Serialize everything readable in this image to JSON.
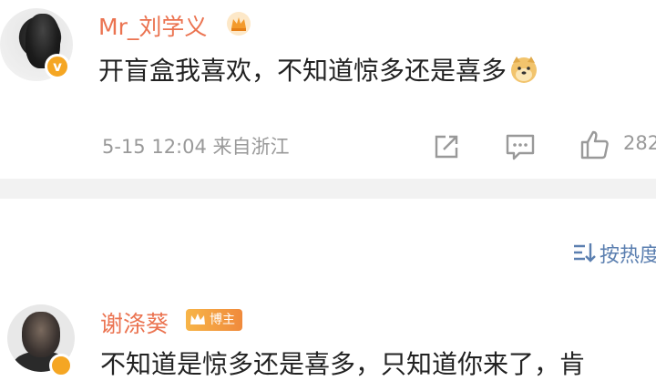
{
  "post": {
    "username": "Mr_刘学义",
    "verified_mark": "v",
    "content_text": "开盲盒我喜欢，不知道惊多还是喜多",
    "emoji": "doge",
    "timestamp": "5-15 12:04",
    "source": "来自浙江",
    "like_count": "282",
    "icons": [
      "crown-icon",
      "share-icon",
      "comment-icon",
      "like-icon"
    ]
  },
  "sort": {
    "label": "按热度"
  },
  "comment": {
    "username": "谢涤葵",
    "badge_label": "博主",
    "content_text": "不知道是惊多还是喜多，只知道你来了，肯"
  },
  "colors": {
    "username": "#eb7350",
    "meta": "#999999",
    "sort_link": "#5b7fb0",
    "divider": "#f2f2f2",
    "badge": "#f5a623"
  }
}
